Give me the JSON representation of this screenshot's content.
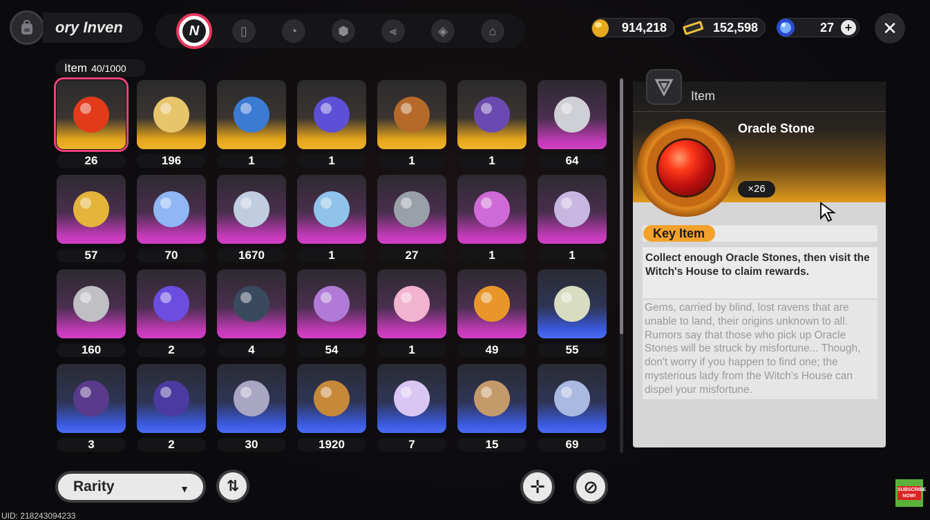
{
  "header": {
    "title": "ory Inven",
    "tabs": [
      {
        "name": "all",
        "icon": "n-logo-icon",
        "active": true
      },
      {
        "name": "gadget",
        "icon": "gameboy-icon"
      },
      {
        "name": "records",
        "icon": "disc-book-icon"
      },
      {
        "name": "materials",
        "icon": "cube-icon"
      },
      {
        "name": "food",
        "icon": "fork-knife-icon"
      },
      {
        "name": "gifts",
        "icon": "crystal-icon"
      },
      {
        "name": "home",
        "icon": "house-icon"
      }
    ],
    "currencies": [
      {
        "name": "coin",
        "value": "914,218",
        "icon": "gold-egg-icon"
      },
      {
        "name": "ticket",
        "value": "152,598",
        "icon": "ticket-icon"
      },
      {
        "name": "orb",
        "value": "27",
        "icon": "blue-orb-icon"
      }
    ]
  },
  "inventory": {
    "label": "Item",
    "count": "40/1000",
    "items": [
      {
        "qty": "26",
        "rarity": "gold",
        "icon": "oracle-stone-icon",
        "color": "#e33a1a"
      },
      {
        "qty": "196",
        "rarity": "gold",
        "icon": "chess-trophy-icon",
        "color": "#e8c46a"
      },
      {
        "qty": "1",
        "rarity": "gold",
        "icon": "thread-spool-icon",
        "color": "#3b7bd4"
      },
      {
        "qty": "1",
        "rarity": "gold",
        "icon": "hover-board-icon",
        "color": "#5d4fd6"
      },
      {
        "qty": "1",
        "rarity": "gold",
        "icon": "ticket-card-icon",
        "color": "#b66a2a"
      },
      {
        "qty": "1",
        "rarity": "gold",
        "icon": "envelope-icon",
        "color": "#6a4ab0"
      },
      {
        "qty": "64",
        "rarity": "purple",
        "icon": "tablet-icon",
        "color": "#cfd0d6"
      },
      {
        "qty": "57",
        "rarity": "purple",
        "icon": "dial-card-icon",
        "color": "#e4b53a"
      },
      {
        "qty": "70",
        "rarity": "purple",
        "icon": "crystal-cluster-icon",
        "color": "#8fb6f5"
      },
      {
        "qty": "1670",
        "rarity": "purple",
        "icon": "ice-flask-icon",
        "color": "#c0cde0"
      },
      {
        "qty": "1",
        "rarity": "purple",
        "icon": "water-bottle-icon",
        "color": "#8fc3ea"
      },
      {
        "qty": "27",
        "rarity": "purple",
        "icon": "wire-spool-icon",
        "color": "#9aa0a8"
      },
      {
        "qty": "1",
        "rarity": "purple",
        "icon": "paint-bucket-icon",
        "color": "#d06ad6"
      },
      {
        "qty": "1",
        "rarity": "purple",
        "icon": "glitch-scroll-icon",
        "color": "#c7b7e0"
      },
      {
        "qty": "160",
        "rarity": "purple",
        "icon": "silver-coin-icon",
        "color": "#bfbfc4"
      },
      {
        "qty": "2",
        "rarity": "purple",
        "icon": "energy-can-icon",
        "color": "#6b4de0"
      },
      {
        "qty": "4",
        "rarity": "purple",
        "icon": "battery-box-icon",
        "color": "#3a4a5e"
      },
      {
        "qty": "54",
        "rarity": "purple",
        "icon": "glitch-shard-icon",
        "color": "#b07ad6"
      },
      {
        "qty": "1",
        "rarity": "purple",
        "icon": "cloud-icon",
        "color": "#f2b3cf"
      },
      {
        "qty": "49",
        "rarity": "purple",
        "icon": "rabbit-badge-icon",
        "color": "#e8962a"
      },
      {
        "qty": "55",
        "rarity": "blue",
        "icon": "circuit-card-icon",
        "color": "#d8dcc0"
      },
      {
        "qty": "3",
        "rarity": "blue",
        "icon": "spinner-icon",
        "color": "#5a3a8a"
      },
      {
        "qty": "2",
        "rarity": "blue",
        "icon": "lens-tube-icon",
        "color": "#4b3aa0"
      },
      {
        "qty": "30",
        "rarity": "blue",
        "icon": "fish-tail-icon",
        "color": "#a9a6c4"
      },
      {
        "qty": "1920",
        "rarity": "blue",
        "icon": "bronze-coin-icon",
        "color": "#c6893a"
      },
      {
        "qty": "7",
        "rarity": "blue",
        "icon": "bubble-fish-icon",
        "color": "#d9c6f2"
      },
      {
        "qty": "15",
        "rarity": "blue",
        "icon": "cookie-bag-icon",
        "color": "#c49a6a"
      },
      {
        "qty": "69",
        "rarity": "blue",
        "icon": "paint-tube-icon",
        "color": "#a9b9e0"
      }
    ]
  },
  "detail": {
    "category": "Item",
    "name": "Oracle Stone",
    "count": "×26",
    "tag": "Key Item",
    "description": "Collect enough Oracle Stones, then visit the Witch's House to claim rewards.",
    "lore": "Gems, carried by blind, lost ravens that are unable to land, their origins unknown to all. Rumors say that those who pick up Oracle Stones will be struck by misfortune... Though, don't worry if you happen to find one; the mysterious lady from the Witch's House can dispel your misfortune."
  },
  "footer": {
    "sort_label": "Rarity",
    "uid": "UID: 218243094233",
    "subscribe": "SUBSCRIBE NOW!"
  },
  "colors": {
    "accent": "#e8365d",
    "gold": "#f1b52a",
    "purple": "#d23fc6",
    "blue": "#4b6cf2",
    "key_tag": "#f2a12d"
  }
}
